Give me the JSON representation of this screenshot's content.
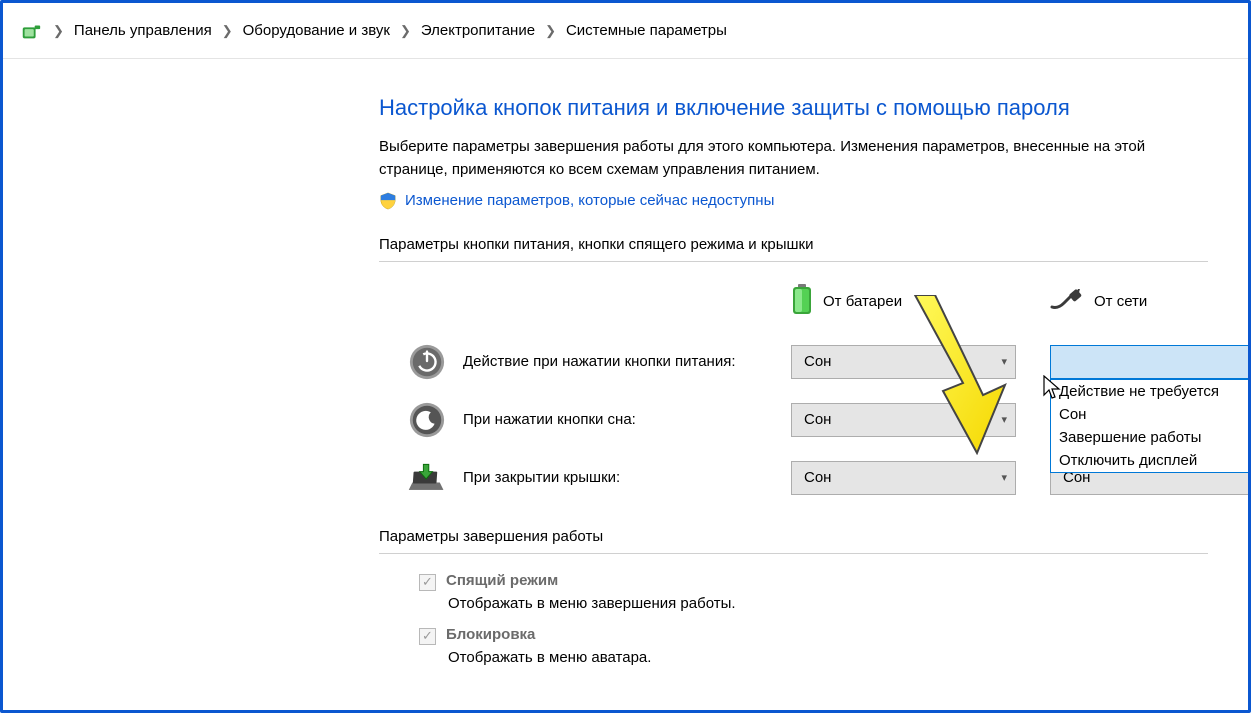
{
  "breadcrumb": {
    "items": [
      "Панель управления",
      "Оборудование и звук",
      "Электропитание",
      "Системные параметры"
    ]
  },
  "title": "Настройка кнопок питания и включение защиты с помощью пароля",
  "description": "Выберите параметры завершения работы для этого компьютера. Изменения параметров, внесенные на этой странице, применяются ко всем схемам управления питанием.",
  "uac_link": "Изменение параметров, которые сейчас недоступны",
  "section_buttons_label": "Параметры кнопки питания, кнопки спящего режима и крышки",
  "columns": {
    "battery": "От батареи",
    "plugged": "От сети"
  },
  "rows": {
    "power_button": {
      "label": "Действие при нажатии кнопки питания:",
      "battery": "Сон",
      "plugged": ""
    },
    "sleep_button": {
      "label": "При нажатии кнопки сна:",
      "battery": "Сон",
      "plugged": ""
    },
    "lid_close": {
      "label": "При закрытии крышки:",
      "battery": "Сон",
      "plugged": "Сон"
    }
  },
  "dropdown_options": [
    "Действие не требуется",
    "Сон",
    "Завершение работы",
    "Отключить дисплей"
  ],
  "section_shutdown_label": "Параметры завершения работы",
  "shutdown": {
    "sleep": {
      "label": "Спящий режим",
      "sub": "Отображать в меню завершения работы."
    },
    "lock": {
      "label": "Блокировка",
      "sub": "Отображать в меню аватара."
    }
  }
}
